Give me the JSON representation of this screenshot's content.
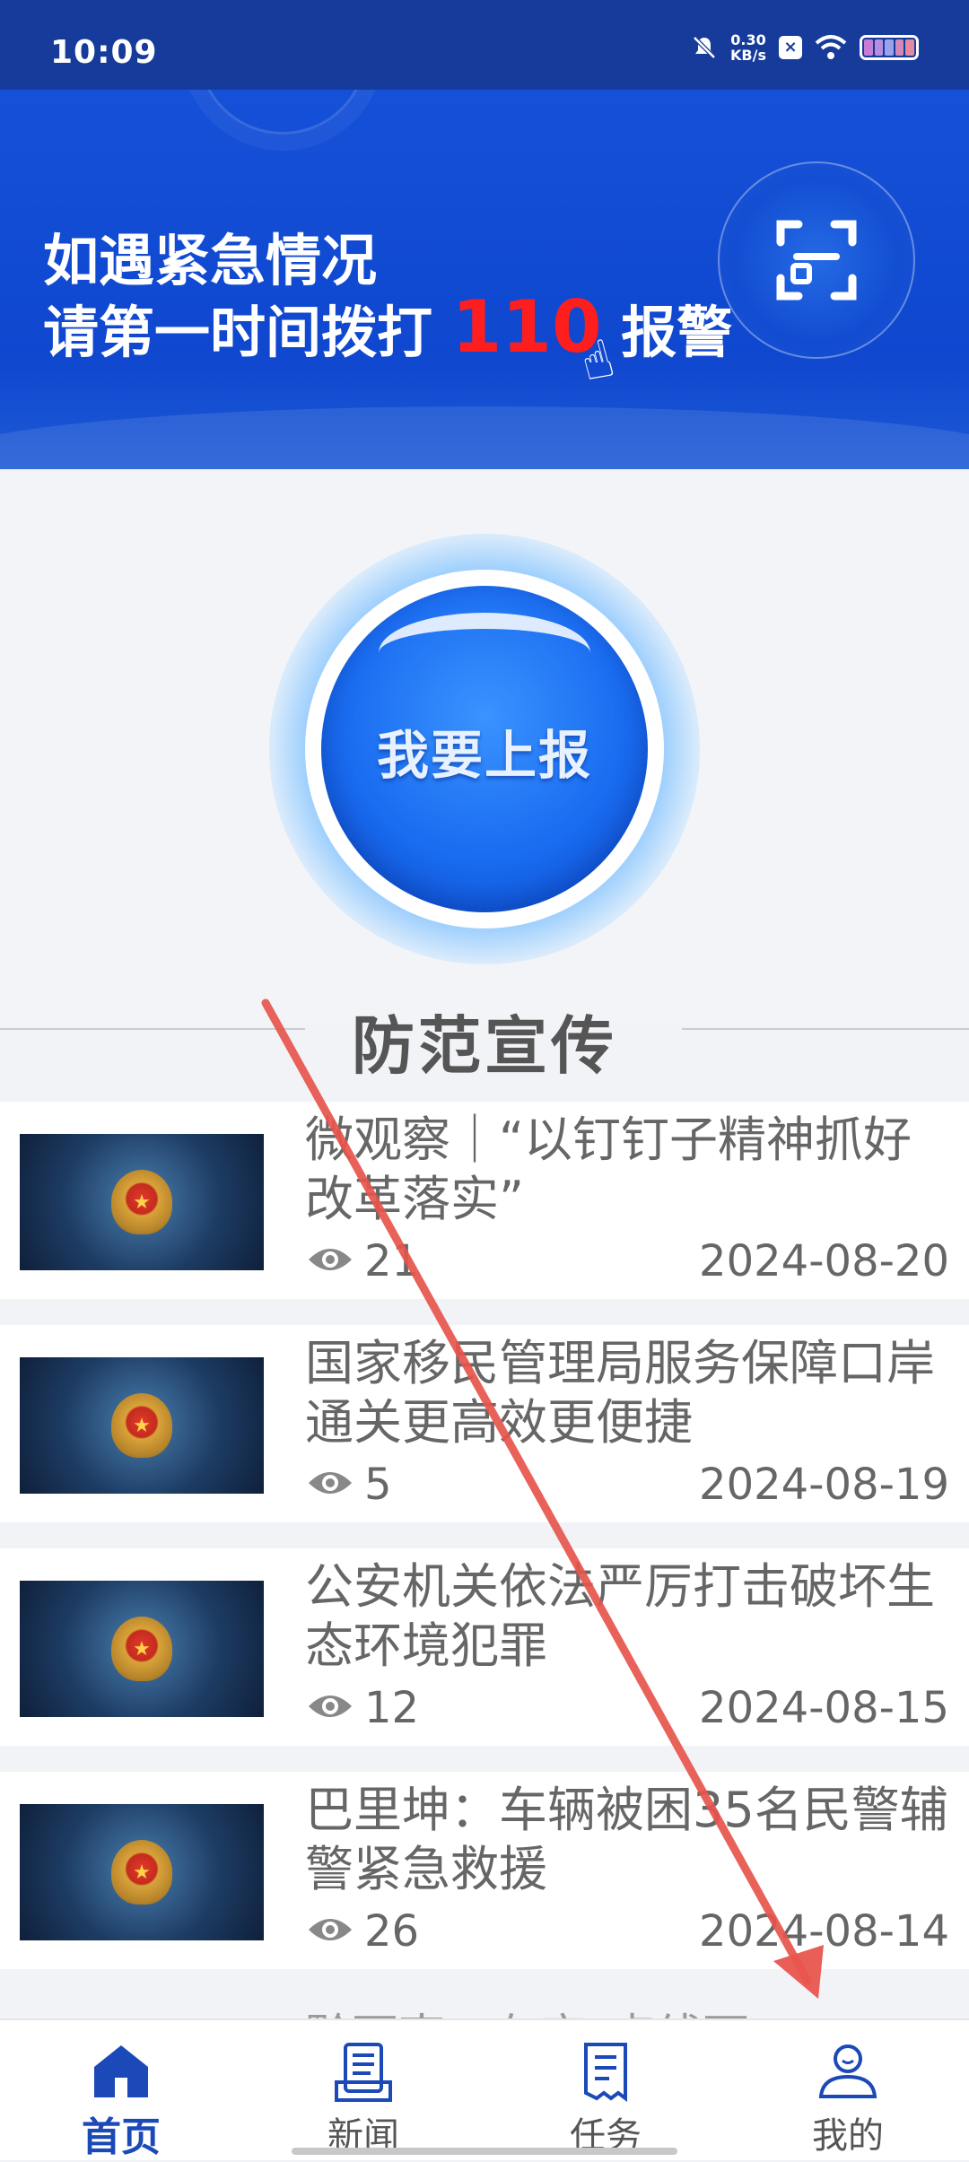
{
  "status_bar": {
    "time": "10:09",
    "net_speed_value": "0.30",
    "net_speed_unit": "KB/s",
    "icons": [
      "mute-icon",
      "sim-x-icon",
      "wifi-icon",
      "battery-icon"
    ]
  },
  "banner": {
    "line1": "如遇紧急情况",
    "line2_prefix": "请第一时间拨打",
    "emergency_number": "110",
    "line2_suffix": "报警",
    "scan_icon": "scan-icon"
  },
  "report_button": {
    "label": "我要上报"
  },
  "section": {
    "title": "防范宣传"
  },
  "news": [
    {
      "title": "微观察｜“以钉钉子精神抓好改革落实”",
      "views": "21",
      "date": "2024-08-20"
    },
    {
      "title": "国家移民管理局服务保障口岸通关更高效更便捷",
      "views": "5",
      "date": "2024-08-19"
    },
    {
      "title": "公安机关依法严厉打击破坏生态环境犯罪",
      "views": "12",
      "date": "2024-08-15"
    },
    {
      "title": "巴里坤：车辆被困35名民警辅警紧急救援",
      "views": "26",
      "date": "2024-08-14"
    }
  ],
  "news_peek": "黔西南：有序“点线面”...",
  "tabs": [
    {
      "label": "首页",
      "icon": "home-icon",
      "active": true
    },
    {
      "label": "新闻",
      "icon": "news-icon",
      "active": false
    },
    {
      "label": "任务",
      "icon": "task-icon",
      "active": false
    },
    {
      "label": "我的",
      "icon": "profile-icon",
      "active": false
    }
  ],
  "colors": {
    "status_bar": "#163b9a",
    "banner": "#0f47cf",
    "accent": "#1b49b8",
    "emergency": "#ff1e1e",
    "annotation_arrow": "#e8554d"
  }
}
